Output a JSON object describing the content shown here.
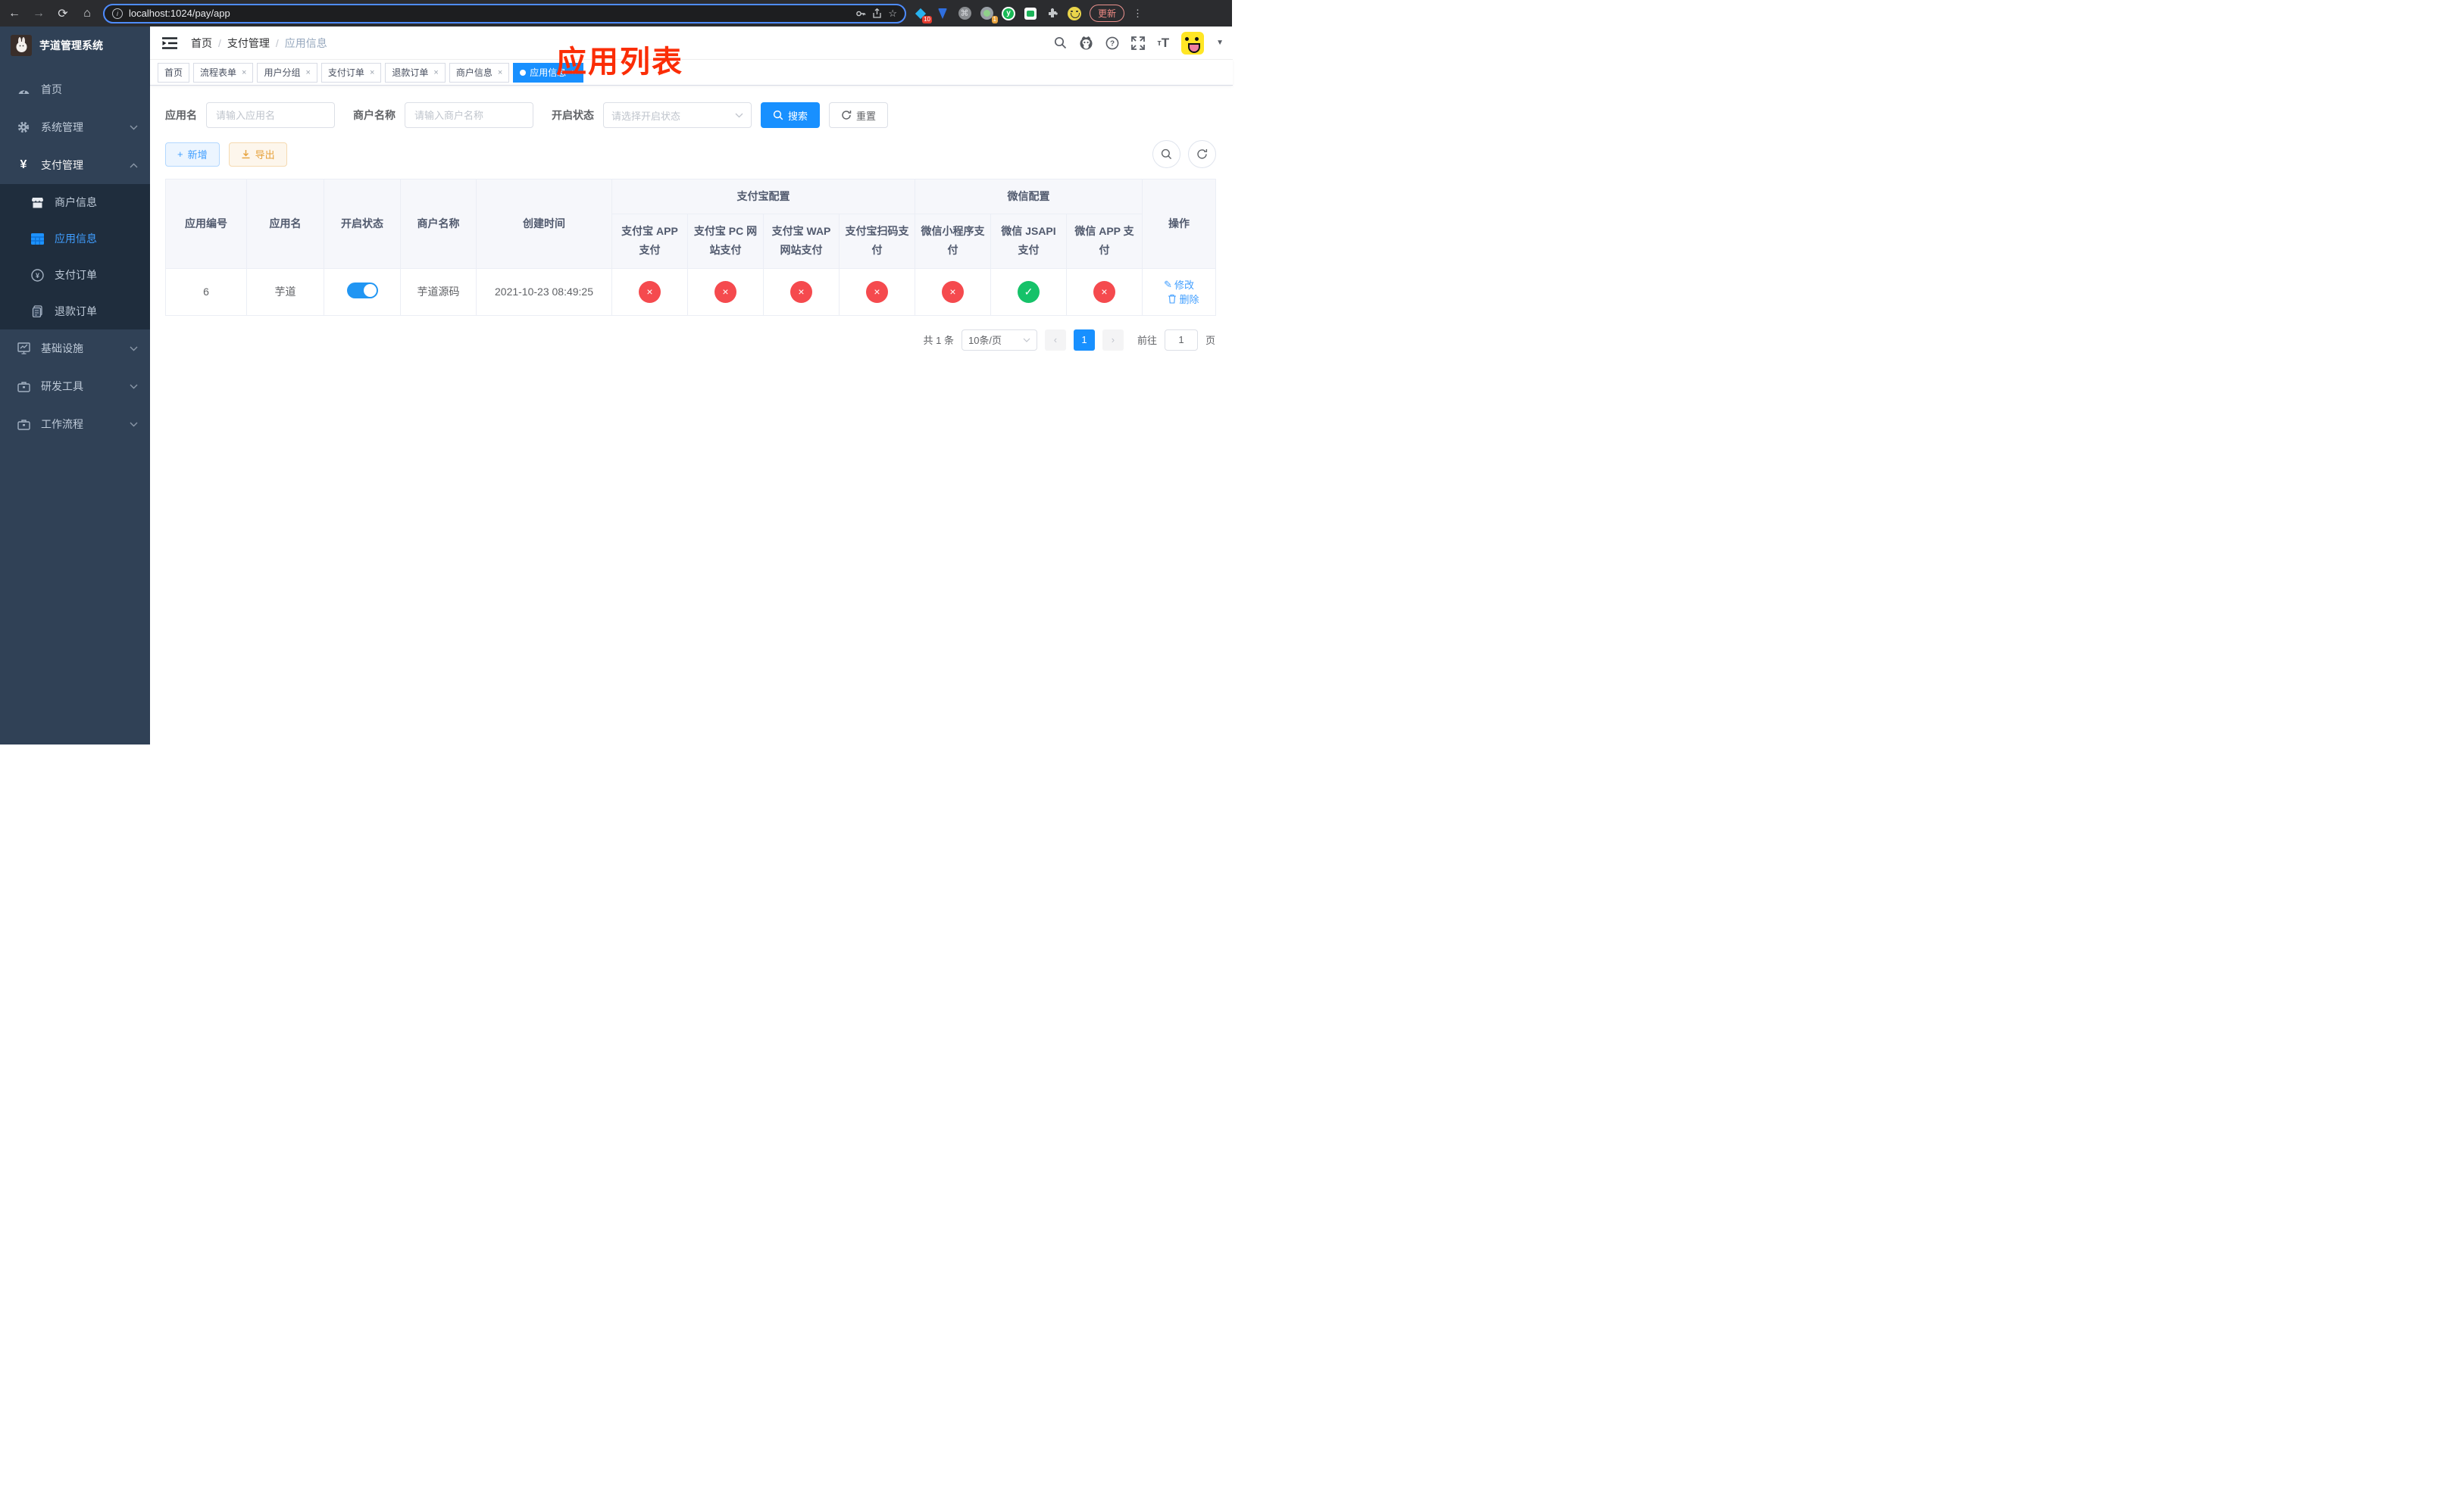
{
  "browser": {
    "url": "localhost:1024/pay/app",
    "update_label": "更新",
    "ext_badge_blue": "10",
    "ext_badge_rec": "1"
  },
  "sidebar": {
    "title": "芋道管理系统",
    "items": [
      {
        "label": "首页"
      },
      {
        "label": "系统管理"
      },
      {
        "label": "支付管理"
      },
      {
        "label": "商户信息"
      },
      {
        "label": "应用信息"
      },
      {
        "label": "支付订单"
      },
      {
        "label": "退款订单"
      },
      {
        "label": "基础设施"
      },
      {
        "label": "研发工具"
      },
      {
        "label": "工作流程"
      }
    ]
  },
  "header": {
    "breadcrumb": [
      "首页",
      "支付管理",
      "应用信息"
    ],
    "annotation": "应用列表"
  },
  "tabs": [
    {
      "label": "首页"
    },
    {
      "label": "流程表单"
    },
    {
      "label": "用户分组"
    },
    {
      "label": "支付订单"
    },
    {
      "label": "退款订单"
    },
    {
      "label": "商户信息"
    },
    {
      "label": "应用信息"
    }
  ],
  "filters": {
    "app_name_label": "应用名",
    "app_name_placeholder": "请输入应用名",
    "merchant_label": "商户名称",
    "merchant_placeholder": "请输入商户名称",
    "status_label": "开启状态",
    "status_placeholder": "请选择开启状态",
    "search_label": "搜索",
    "reset_label": "重置"
  },
  "toolbar": {
    "add_label": "新增",
    "export_label": "导出"
  },
  "table": {
    "columns": [
      "应用编号",
      "应用名",
      "开启状态",
      "商户名称",
      "创建时间"
    ],
    "groups": [
      {
        "label": "支付宝配置",
        "children": [
          "支付宝 APP 支付",
          "支付宝 PC 网站支付",
          "支付宝 WAP 网站支付",
          "支付宝扫码支付"
        ]
      },
      {
        "label": "微信配置",
        "children": [
          "微信小程序支付",
          "微信 JSAPI 支付",
          "微信 APP 支付"
        ]
      }
    ],
    "op_column": "操作",
    "row": {
      "id": "6",
      "name": "芋道",
      "enabled": true,
      "merchant": "芋道源码",
      "created": "2021-10-23 08:49:25",
      "channels": [
        "no",
        "no",
        "no",
        "no",
        "no",
        "ok",
        "no"
      ],
      "edit_label": "修改",
      "delete_label": "删除"
    }
  },
  "pagination": {
    "total_text": "共 1 条",
    "page_size": "10条/页",
    "current_page": "1",
    "goto_label": "前往",
    "goto_value": "1",
    "page_suffix": "页"
  },
  "colors": {
    "accent_blue": "#1890ff",
    "link_blue": "#409eff",
    "success_green": "#16c269",
    "danger_red": "#f54a4e",
    "sidebar_bg": "#304156",
    "submenu_bg": "#1f2d3d",
    "annotation_red": "#fb2d06"
  }
}
